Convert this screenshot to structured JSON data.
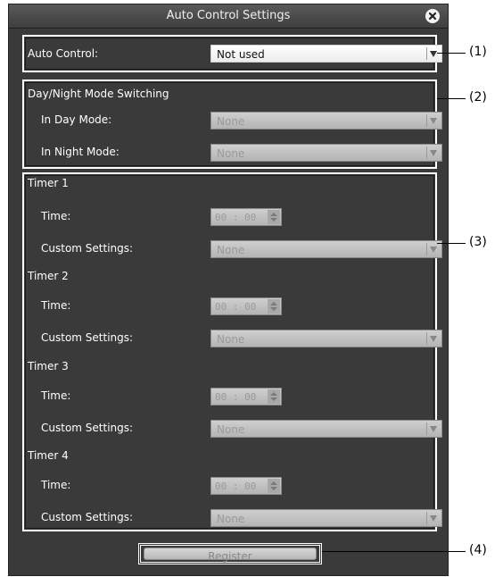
{
  "dialog": {
    "title": "Auto Control Settings"
  },
  "auto_control": {
    "label": "Auto Control:",
    "value": "Not used"
  },
  "day_night": {
    "heading": "Day/Night Mode Switching",
    "day_label": "In Day Mode:",
    "day_value": "None",
    "night_label": "In Night Mode:",
    "night_value": "None"
  },
  "timers": [
    {
      "heading": "Timer 1",
      "time_label": "Time:",
      "time_value": "00 : 00",
      "custom_label": "Custom Settings:",
      "custom_value": "None"
    },
    {
      "heading": "Timer 2",
      "time_label": "Time:",
      "time_value": "00 : 00",
      "custom_label": "Custom Settings:",
      "custom_value": "None"
    },
    {
      "heading": "Timer 3",
      "time_label": "Time:",
      "time_value": "00 : 00",
      "custom_label": "Custom Settings:",
      "custom_value": "None"
    },
    {
      "heading": "Timer 4",
      "time_label": "Time:",
      "time_value": "00 : 00",
      "custom_label": "Custom Settings:",
      "custom_value": "None"
    }
  ],
  "register_label": "Register",
  "callouts": [
    "(1)",
    "(2)",
    "(3)",
    "(4)"
  ],
  "icons": {
    "close": "close-icon",
    "dropdown": "chevron-down-icon",
    "spinner": "spinner-icon"
  }
}
